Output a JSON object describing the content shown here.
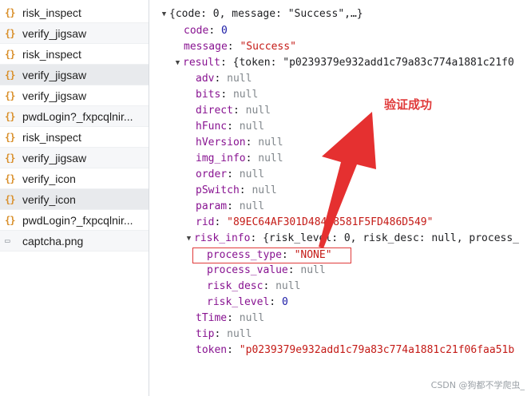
{
  "network_list": [
    {
      "icon": "{}",
      "name": "risk_inspect"
    },
    {
      "icon": "{}",
      "name": "verify_jigsaw"
    },
    {
      "icon": "{}",
      "name": "risk_inspect"
    },
    {
      "icon": "{}",
      "name": "verify_jigsaw"
    },
    {
      "icon": "{}",
      "name": "verify_jigsaw"
    },
    {
      "icon": "{}",
      "name": "pwdLogin?_fxpcqlnir..."
    },
    {
      "icon": "{}",
      "name": "risk_inspect"
    },
    {
      "icon": "{}",
      "name": "verify_jigsaw"
    },
    {
      "icon": "{}",
      "name": "verify_icon"
    },
    {
      "icon": "{}",
      "name": "verify_icon"
    },
    {
      "icon": "{}",
      "name": "pwdLogin?_fxpcqlnir..."
    },
    {
      "icon": "▭",
      "name": "captcha.png"
    }
  ],
  "preview": {
    "root_summary": "{code: 0, message: \"Success\",…}",
    "code_key": "code",
    "code_val": "0",
    "message_key": "message",
    "message_val": "\"Success\"",
    "result_key": "result",
    "result_summary": "{token: \"p0239379e932add1c79a83c774a1881c21f0",
    "fields": [
      {
        "key": "adv",
        "val": "null"
      },
      {
        "key": "bits",
        "val": "null"
      },
      {
        "key": "direct",
        "val": "null"
      },
      {
        "key": "hFunc",
        "val": "null"
      },
      {
        "key": "hVersion",
        "val": "null"
      },
      {
        "key": "img_info",
        "val": "null"
      },
      {
        "key": "order",
        "val": "null"
      },
      {
        "key": "pSwitch",
        "val": "null"
      },
      {
        "key": "param",
        "val": "null"
      }
    ],
    "rid_key": "rid",
    "rid_val": "\"89EC64AF301D484B8581F5FD486D549\"",
    "risk_info_key": "risk_info",
    "risk_info_summary": "{risk_level: 0, risk_desc: null, process_",
    "risk_fields": [
      {
        "key": "process_type",
        "val": "\"NONE\"",
        "type": "string"
      },
      {
        "key": "process_value",
        "val": "null",
        "type": "null"
      },
      {
        "key": "risk_desc",
        "val": "null",
        "type": "null"
      },
      {
        "key": "risk_level",
        "val": "0",
        "type": "number"
      }
    ],
    "tTime_key": "tTime",
    "tTime_val": "null",
    "tip_key": "tip",
    "tip_val": "null",
    "token_key": "token",
    "token_val": "\"p0239379e932add1c79a83c774a1881c21f06faa51b"
  },
  "annotation": {
    "text": "验证成功",
    "color": "#e03a3a"
  },
  "watermark": "CSDN @狗都不学爬虫_",
  "colors": {
    "key": "#881391",
    "number": "#1a1aa6",
    "string": "#c41a16",
    "null": "#80868b",
    "file_icon": "#d9902c"
  },
  "icons": {
    "expanded": "triangle-down-icon",
    "json_file": "json-braces-icon",
    "image_file": "image-file-icon"
  }
}
